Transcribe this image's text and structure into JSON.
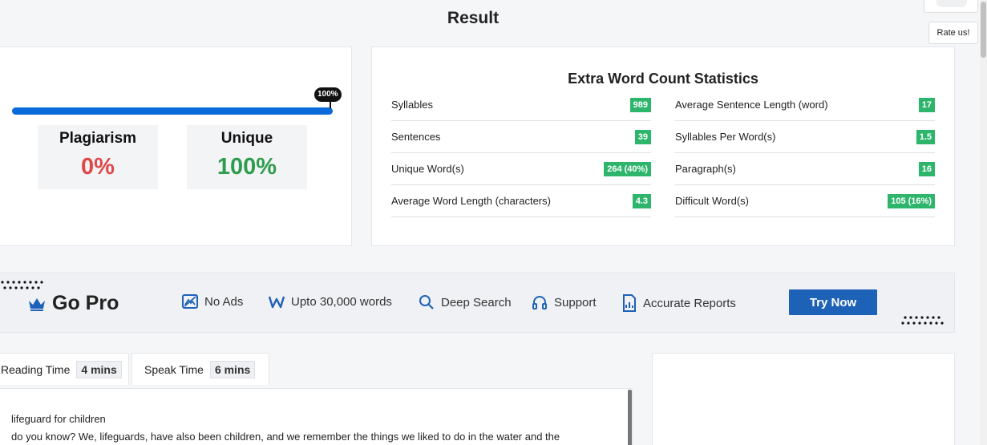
{
  "page": {
    "title": "Result"
  },
  "rate": {
    "label": "Rate us!"
  },
  "result": {
    "progress_label": "100%",
    "progress_value": 100,
    "plagiarism": {
      "label": "Plagiarism",
      "value": "0%"
    },
    "unique": {
      "label": "Unique",
      "value": "100%"
    }
  },
  "stats": {
    "title": "Extra Word Count Statistics",
    "left": [
      {
        "label": "Syllables",
        "value": "989"
      },
      {
        "label": "Sentences",
        "value": "39"
      },
      {
        "label": "Unique Word(s)",
        "value": "264 (40%)"
      },
      {
        "label": "Average Word Length (characters)",
        "value": "4.3"
      }
    ],
    "right": [
      {
        "label": "Average Sentence Length (word)",
        "value": "17"
      },
      {
        "label": "Syllables Per Word(s)",
        "value": "1.5"
      },
      {
        "label": "Paragraph(s)",
        "value": "16"
      },
      {
        "label": "Difficult Word(s)",
        "value": "105 (16%)"
      }
    ]
  },
  "gopro": {
    "title": "Go Pro",
    "features": [
      {
        "label": "No Ads",
        "icon": "no-ads-icon"
      },
      {
        "label": "Upto 30,000 words",
        "icon": "word-w-icon"
      },
      {
        "label": "Deep Search",
        "icon": "search-icon"
      },
      {
        "label": "Support",
        "icon": "headphones-icon"
      },
      {
        "label": "Accurate Reports",
        "icon": "report-icon"
      }
    ],
    "cta": "Try Now"
  },
  "tabs": [
    {
      "label": "Reading Time",
      "value": "4 mins"
    },
    {
      "label": "Speak Time",
      "value": "6 mins"
    }
  ],
  "text": {
    "line1": "lifeguard for children",
    "line2": "do you know? We, lifeguards, have also been children, and we remember the things we liked to do in the water and the"
  },
  "colors": {
    "accent": "#1e62b8",
    "progress": "#0a6ad9",
    "badge": "#2db56b",
    "plagiarism": "#e04848",
    "unique": "#2e9c4d"
  }
}
